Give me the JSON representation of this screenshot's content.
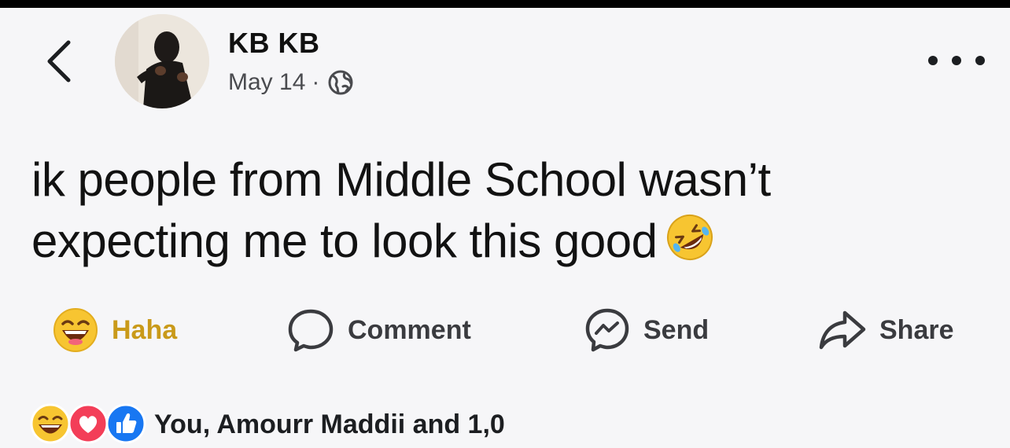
{
  "post": {
    "author_name": "KB KB",
    "date": "May 14",
    "separator": "·",
    "privacy_icon": "globe-icon",
    "text": "ik people from Middle School wasn’t expecting me to look this good",
    "text_emoji": "rolling-on-floor-laughing-emoji"
  },
  "header": {
    "back_icon": "chevron-left-icon",
    "more_icon": "more-dots-icon"
  },
  "actions": {
    "haha_label": "Haha",
    "comment_label": "Comment",
    "send_label": "Send",
    "share_label": "Share"
  },
  "reactions": {
    "icons": [
      "haha-reaction-icon",
      "love-reaction-icon",
      "like-reaction-icon"
    ],
    "summary": "You, Amourr Maddii and 1,0"
  },
  "colors": {
    "background": "#f6f6f8",
    "haha_label": "#c99a1a",
    "like_blue": "#1877f2",
    "love_pink": "#f33e58"
  }
}
